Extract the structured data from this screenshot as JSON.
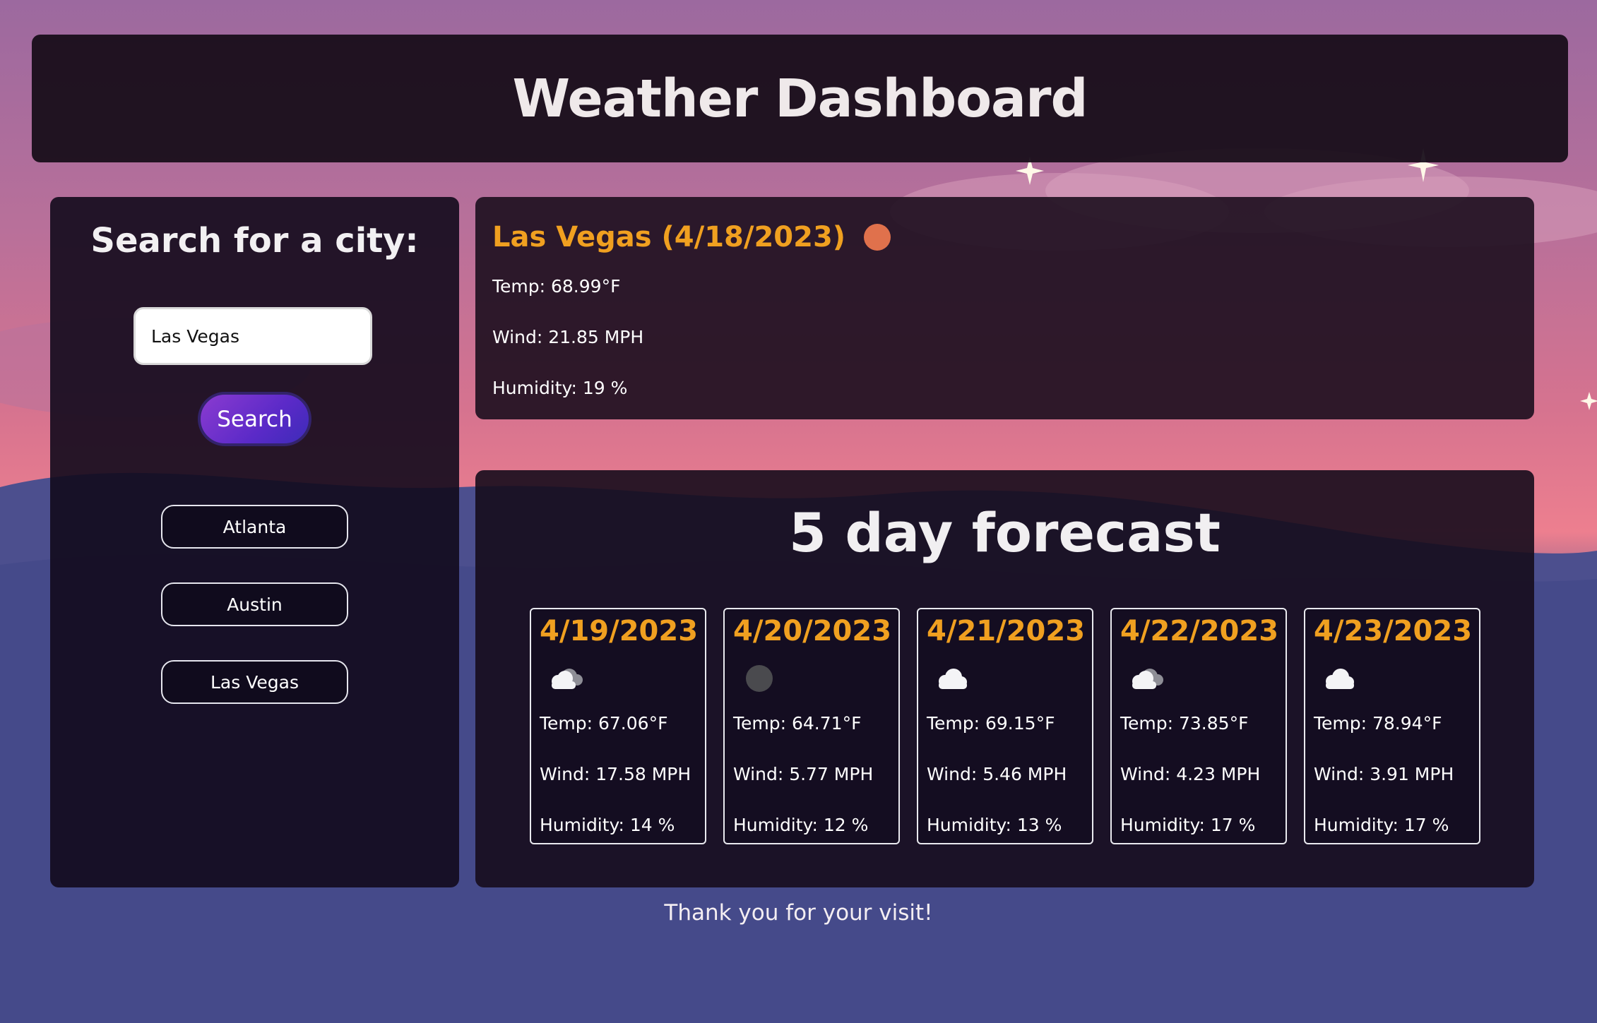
{
  "header": {
    "title": "Weather Dashboard"
  },
  "search": {
    "heading": "Search for a city:",
    "input_value": "Las Vegas",
    "button_label": "Search",
    "history": [
      "Atlanta",
      "Austin",
      "Las Vegas"
    ]
  },
  "current": {
    "title": "Las Vegas (4/18/2023)",
    "icon": "sun-icon",
    "temp": "Temp: 68.99°F",
    "wind": "Wind: 21.85 MPH",
    "humidity": "Humidity: 19 %"
  },
  "forecast": {
    "heading": "5 day forecast",
    "days": [
      {
        "date": "4/19/2023",
        "icon": "cloud-partial-icon",
        "temp": "Temp: 67.06°F",
        "wind": "Wind: 17.58 MPH",
        "humidity": "Humidity: 14 %"
      },
      {
        "date": "4/20/2023",
        "icon": "clear-night-icon",
        "temp": "Temp: 64.71°F",
        "wind": "Wind: 5.77 MPH",
        "humidity": "Humidity: 12 %"
      },
      {
        "date": "4/21/2023",
        "icon": "cloud-icon",
        "temp": "Temp: 69.15°F",
        "wind": "Wind: 5.46 MPH",
        "humidity": "Humidity: 13 %"
      },
      {
        "date": "4/22/2023",
        "icon": "cloud-partial-icon",
        "temp": "Temp: 73.85°F",
        "wind": "Wind: 4.23 MPH",
        "humidity": "Humidity: 17 %"
      },
      {
        "date": "4/23/2023",
        "icon": "cloud-icon",
        "temp": "Temp: 78.94°F",
        "wind": "Wind: 3.91 MPH",
        "humidity": "Humidity: 17 %"
      }
    ]
  },
  "footer": {
    "text": "Thank you for your visit!"
  },
  "colors": {
    "accent": "#f0a020",
    "button": "#7a35cc",
    "sun": "#e0714c"
  }
}
